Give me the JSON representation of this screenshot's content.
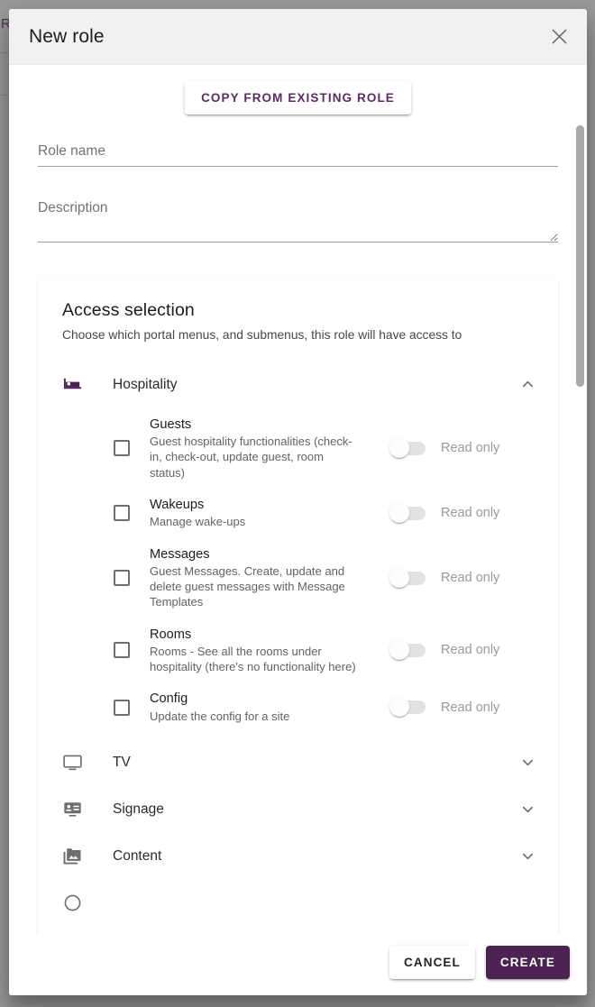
{
  "background": {
    "letter": "R"
  },
  "dialog": {
    "title": "New role",
    "close_icon": "close-icon"
  },
  "copy_button": {
    "label": "COPY FROM EXISTING ROLE"
  },
  "form": {
    "role_name": {
      "label": "Role name",
      "placeholder": "Role name",
      "value": ""
    },
    "description": {
      "label": "Description",
      "placeholder": "Description",
      "value": ""
    }
  },
  "access_selection": {
    "title": "Access selection",
    "subtitle": "Choose which portal menus, and submenus, this role will have access to",
    "menus": [
      {
        "label": "Hospitality",
        "icon": "hotel-bed-icon",
        "icon_color": "#4b2252",
        "expanded": true,
        "chevron": "chevron-up-icon",
        "permissions": [
          {
            "title": "Guests",
            "description": "Guest hospitality functionalities (check-in, check-out, update guest, room status)",
            "checked": false,
            "toggle_on": false,
            "toggle_label": "Read only"
          },
          {
            "title": "Wakeups",
            "description": "Manage wake-ups",
            "checked": false,
            "toggle_on": false,
            "toggle_label": "Read only"
          },
          {
            "title": "Messages",
            "description": "Guest Messages. Create, update and delete guest messages with Message Templates",
            "checked": false,
            "toggle_on": false,
            "toggle_label": "Read only"
          },
          {
            "title": "Rooms",
            "description": "Rooms - See all the rooms under hospitality (there's no functionality here)",
            "checked": false,
            "toggle_on": false,
            "toggle_label": "Read only"
          },
          {
            "title": "Config",
            "description": "Update the config for a site",
            "checked": false,
            "toggle_on": false,
            "toggle_label": "Read only"
          }
        ]
      },
      {
        "label": "TV",
        "icon": "monitor-icon",
        "icon_color": "#6e6e6e",
        "expanded": false,
        "chevron": "chevron-down-icon",
        "permissions": []
      },
      {
        "label": "Signage",
        "icon": "signage-icon",
        "icon_color": "#6e6e6e",
        "expanded": false,
        "chevron": "chevron-down-icon",
        "permissions": []
      },
      {
        "label": "Content",
        "icon": "photo-library-icon",
        "icon_color": "#6e6e6e",
        "expanded": false,
        "chevron": "chevron-down-icon",
        "permissions": []
      }
    ]
  },
  "footer": {
    "cancel_label": "CANCEL",
    "create_label": "CREATE",
    "create_color": "#4b2252"
  }
}
